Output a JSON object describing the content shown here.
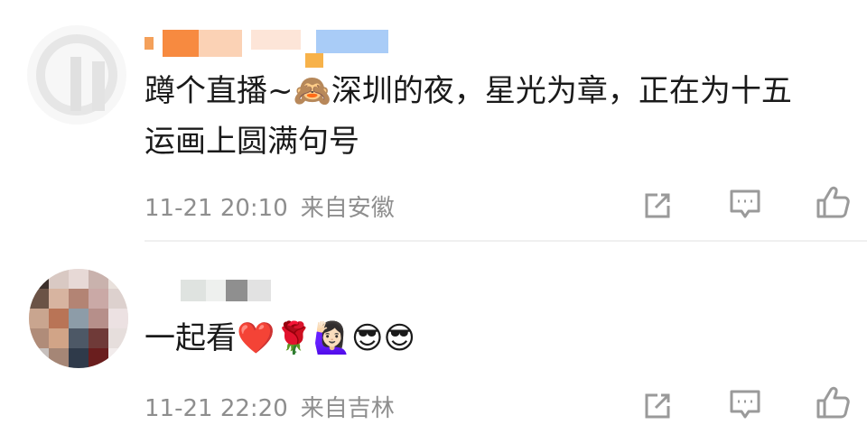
{
  "comments": [
    {
      "text_line1": "蹲个直播~🙈深圳的夜，星光为章，正在为十五",
      "text_line2": "运画上圆满句号",
      "time": "11-21 20:10",
      "location": "来自安徽",
      "actions": [
        "share-icon",
        "comment-icon",
        "like-icon"
      ]
    },
    {
      "text": "一起看❤️🌹🙋🏻‍♀️😎😎",
      "time": "11-21 22:20",
      "location": "来自吉林",
      "actions": [
        "share-icon",
        "comment-icon",
        "like-icon"
      ]
    }
  ],
  "colors": {
    "text": "#1a1a1a",
    "meta": "#8e8e8e",
    "icon": "#9a9a9a",
    "divider": "#f0f0f0",
    "name_blur_orange": "#f7a24a",
    "name_blur_blue": "#9ec7f5"
  }
}
